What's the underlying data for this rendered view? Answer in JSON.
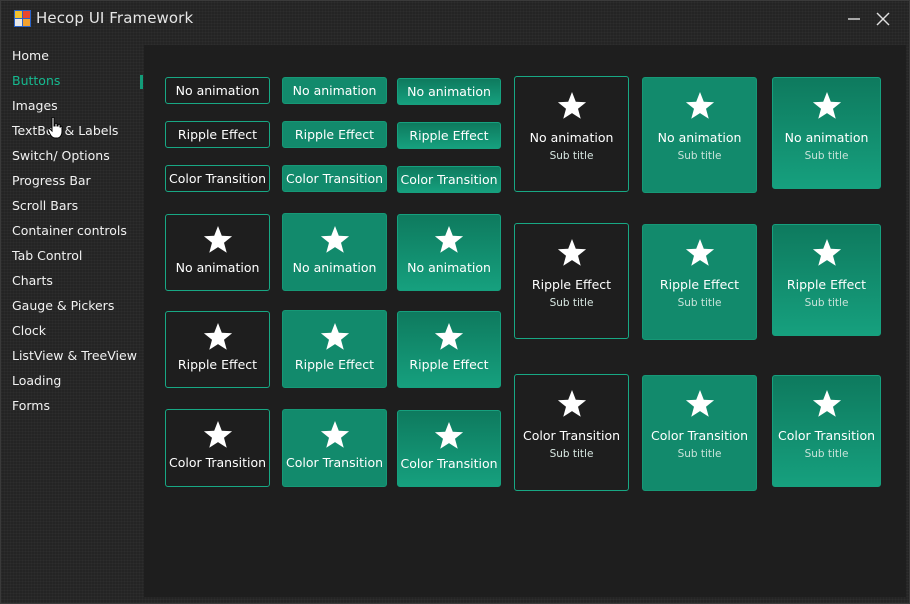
{
  "window": {
    "title": "Hecop UI Framework"
  },
  "sidebar": {
    "items": [
      {
        "label": "Home"
      },
      {
        "label": "Buttons"
      },
      {
        "label": "Images"
      },
      {
        "label": "TextBox & Labels"
      },
      {
        "label": "Switch/ Options"
      },
      {
        "label": "Progress Bar"
      },
      {
        "label": "Scroll Bars"
      },
      {
        "label": "Container controls"
      },
      {
        "label": "Tab Control"
      },
      {
        "label": "Charts"
      },
      {
        "label": "Gauge & Pickers"
      },
      {
        "label": "Clock"
      },
      {
        "label": "ListView & TreeView"
      },
      {
        "label": "Loading"
      },
      {
        "label": "Forms"
      }
    ],
    "active_index": 1
  },
  "text_buttons": [
    {
      "label": "No animation"
    },
    {
      "label": "No animation"
    },
    {
      "label": "No animation"
    },
    {
      "label": "Ripple Effect"
    },
    {
      "label": "Ripple Effect"
    },
    {
      "label": "Ripple Effect"
    },
    {
      "label": "Color Transition"
    },
    {
      "label": "Color Transition"
    },
    {
      "label": "Color Transition"
    }
  ],
  "icon_buttons": [
    {
      "label": "No animation",
      "icon": "star-icon"
    },
    {
      "label": "No animation",
      "icon": "star-icon"
    },
    {
      "label": "No animation",
      "icon": "star-icon"
    },
    {
      "label": "Ripple Effect",
      "icon": "star-icon"
    },
    {
      "label": "Ripple Effect",
      "icon": "star-icon"
    },
    {
      "label": "Ripple Effect",
      "icon": "star-icon"
    },
    {
      "label": "Color Transition",
      "icon": "star-icon"
    },
    {
      "label": "Color Transition",
      "icon": "star-icon"
    },
    {
      "label": "Color Transition",
      "icon": "star-icon"
    }
  ],
  "tile_buttons": [
    {
      "label": "No animation",
      "subtitle": "Sub title",
      "icon": "star-icon"
    },
    {
      "label": "No animation",
      "subtitle": "Sub title",
      "icon": "star-icon"
    },
    {
      "label": "No animation",
      "subtitle": "Sub title",
      "icon": "star-icon"
    },
    {
      "label": "Ripple Effect",
      "subtitle": "Sub title",
      "icon": "star-icon"
    },
    {
      "label": "Ripple Effect",
      "subtitle": "Sub title",
      "icon": "star-icon"
    },
    {
      "label": "Ripple Effect",
      "subtitle": "Sub title",
      "icon": "star-icon"
    },
    {
      "label": "Color Transition",
      "subtitle": "Sub title",
      "icon": "star-icon"
    },
    {
      "label": "Color Transition",
      "subtitle": "Sub title",
      "icon": "star-icon"
    },
    {
      "label": "Color Transition",
      "subtitle": "Sub title",
      "icon": "star-icon"
    }
  ],
  "colors": {
    "accent": "#16b98f",
    "button_fill": "#128a6c",
    "background": "#1e1e1e"
  }
}
